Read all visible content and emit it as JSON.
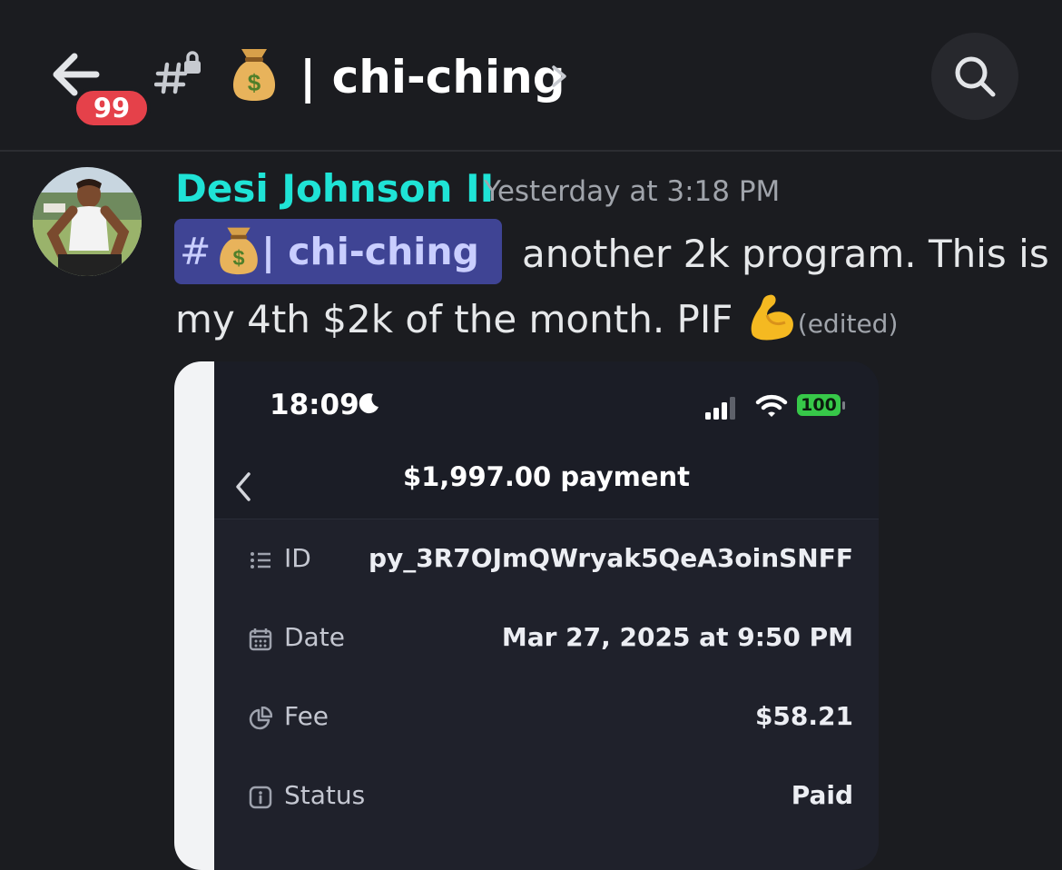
{
  "header": {
    "unread_badge": "99",
    "channel_prefix": "#",
    "channel_emoji": "money-bag",
    "channel_name": "| chi-ching",
    "chevron": "›"
  },
  "message": {
    "author": "Desi Johnson II",
    "timestamp": "Yesterday at 3:18 PM",
    "mention_hash": "#",
    "mention_name": "| chi-ching",
    "line1": "another 2k program. This is",
    "line2": "my 4th $2k of the month. PIF",
    "emoji": "flexed-biceps",
    "edited": "(edited)"
  },
  "attachment": {
    "status_time": "18:09",
    "battery": "100",
    "title": "$1,997.00 payment",
    "rows": [
      {
        "label": "ID",
        "value": "py_3R7OJmQWryak5QeA3oinSNFF",
        "icon": "list-icon"
      },
      {
        "label": "Date",
        "value": "Mar 27, 2025 at 9:50 PM",
        "icon": "calendar-icon"
      },
      {
        "label": "Fee",
        "value": "$58.21",
        "icon": "pie-chart-icon"
      },
      {
        "label": "Status",
        "value": "Paid",
        "icon": "info-icon"
      }
    ]
  },
  "colors": {
    "background": "#1b1c20",
    "author": "#1fe3d6",
    "mention_bg": "#3f4494",
    "badge": "#e5414a",
    "battery": "#37c849"
  }
}
